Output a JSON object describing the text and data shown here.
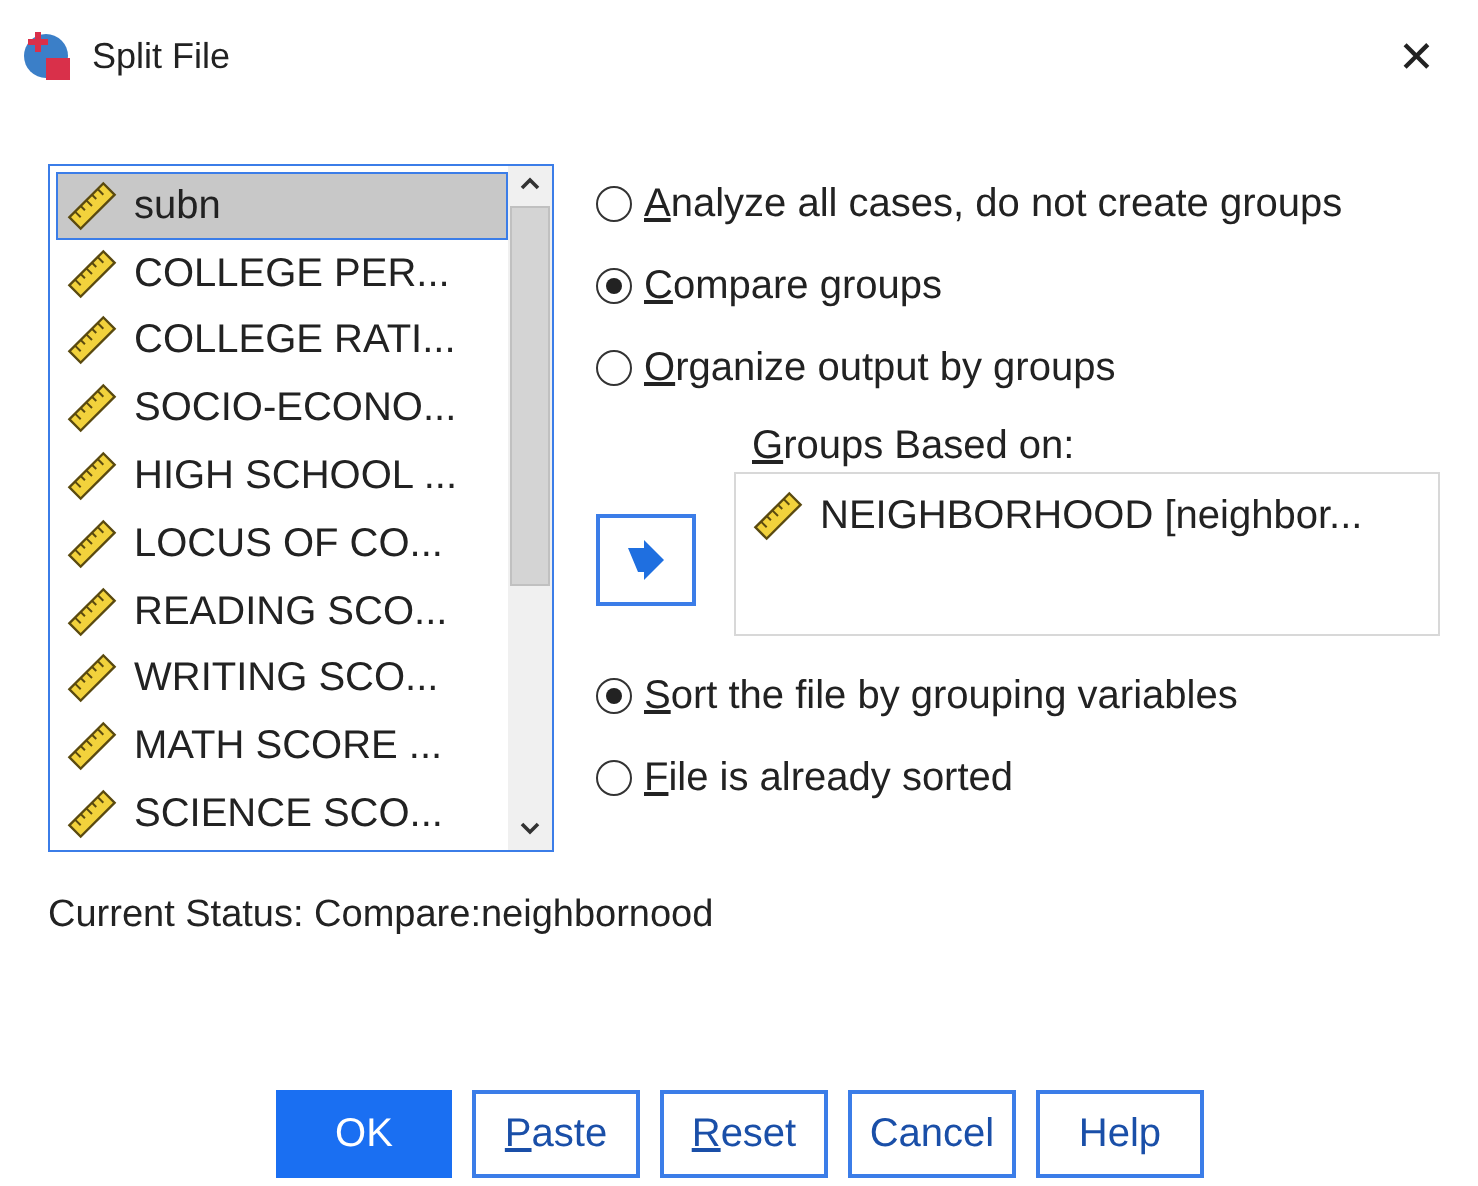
{
  "window": {
    "title": "Split File",
    "close": "✕"
  },
  "variables": [
    {
      "name": "subn",
      "selected": true
    },
    {
      "name": "COLLEGE PER...",
      "selected": false
    },
    {
      "name": "COLLEGE RATI...",
      "selected": false
    },
    {
      "name": "SOCIO-ECONO...",
      "selected": false
    },
    {
      "name": "HIGH SCHOOL ...",
      "selected": false
    },
    {
      "name": "LOCUS OF CO...",
      "selected": false
    },
    {
      "name": "READING SCO...",
      "selected": false
    },
    {
      "name": "WRITING SCO...",
      "selected": false
    },
    {
      "name": "MATH SCORE ...",
      "selected": false
    },
    {
      "name": "SCIENCE SCO...",
      "selected": false
    }
  ],
  "mode_options": [
    {
      "key": "A",
      "rest": "nalyze all cases, do not create groups",
      "selected": false
    },
    {
      "key": "C",
      "rest": "ompare groups",
      "selected": true
    },
    {
      "key": "O",
      "rest": "rganize output by groups",
      "selected": false
    }
  ],
  "groups_based_on": {
    "key": "G",
    "rest": "roups Based on:",
    "items": [
      "NEIGHBORHOOD [neighbor..."
    ]
  },
  "sort_options": [
    {
      "key": "S",
      "rest": "ort the file by grouping variables",
      "selected": true
    },
    {
      "key": "F",
      "rest": "ile is already sorted",
      "selected": false
    }
  ],
  "status": "Current Status: Compare:neighbornood",
  "buttons": [
    {
      "rest": "OK",
      "default": true
    },
    {
      "key": "P",
      "rest": "aste",
      "default": false
    },
    {
      "key": "R",
      "rest": "eset",
      "default": false
    },
    {
      "rest": "Cancel",
      "default": false
    },
    {
      "rest": "Help",
      "default": false
    }
  ]
}
